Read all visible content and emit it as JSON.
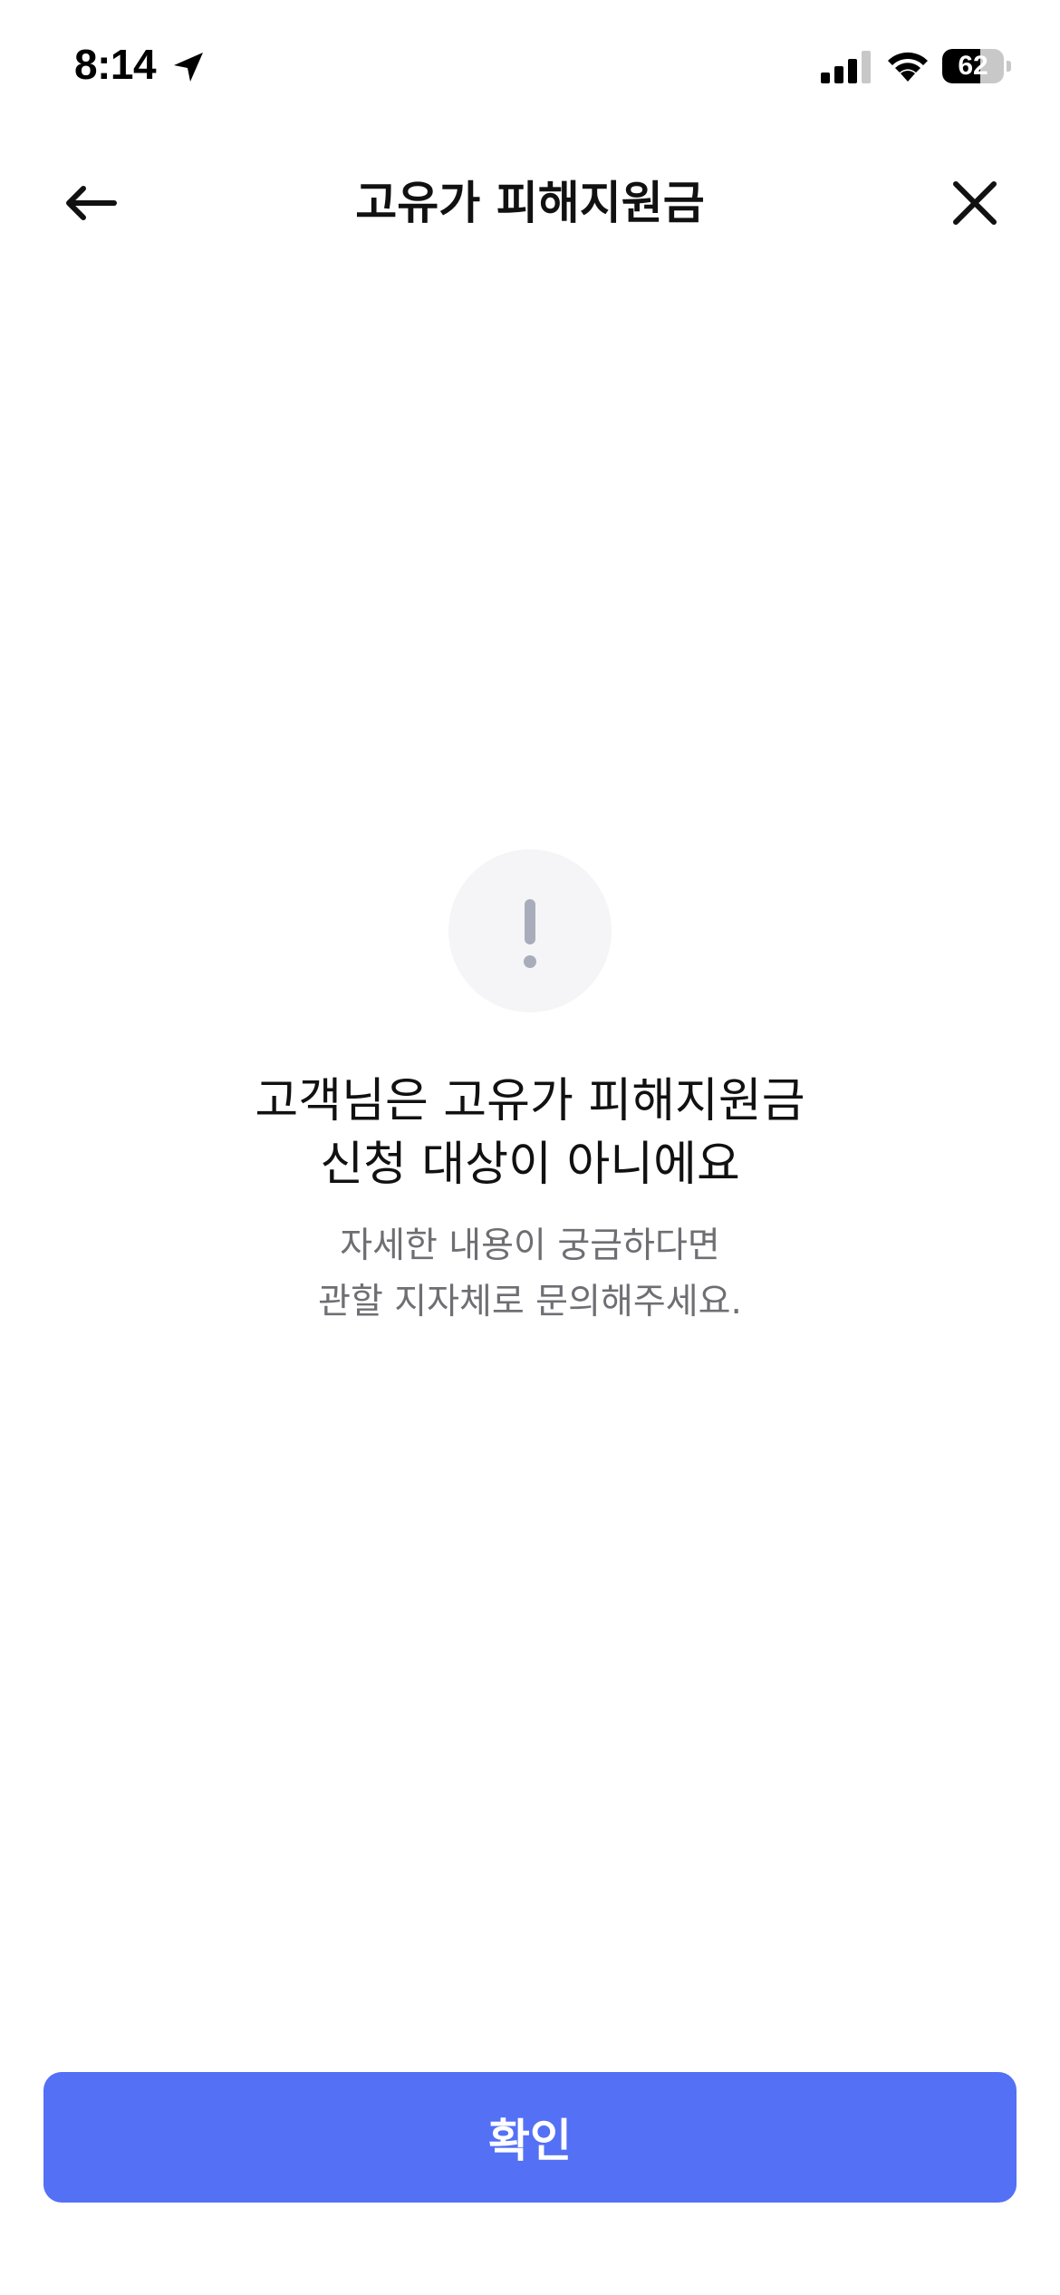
{
  "status_bar": {
    "time": "8:14",
    "battery_level": "62",
    "battery_fraction": 0.62,
    "icons": [
      "location-arrow-icon",
      "cellular-signal-icon",
      "wifi-icon",
      "battery-icon"
    ]
  },
  "header": {
    "title": "고유가 피해지원금",
    "back_icon": "arrow-left-icon",
    "close_icon": "close-icon"
  },
  "message": {
    "icon": "exclamation-icon",
    "title_lines": [
      "고객님은 고유가 피해지원금",
      "신청 대상이 아니에요"
    ],
    "description_lines": [
      "자세한 내용이 궁금하다면",
      "관할 지자체로 문의해주세요."
    ]
  },
  "actions": {
    "confirm_label": "확인"
  },
  "colors": {
    "accent": "#5470f5",
    "icon_circle": "#f5f5f7",
    "exclamation": "#a9adbb",
    "secondary_text": "#6e6e73"
  }
}
